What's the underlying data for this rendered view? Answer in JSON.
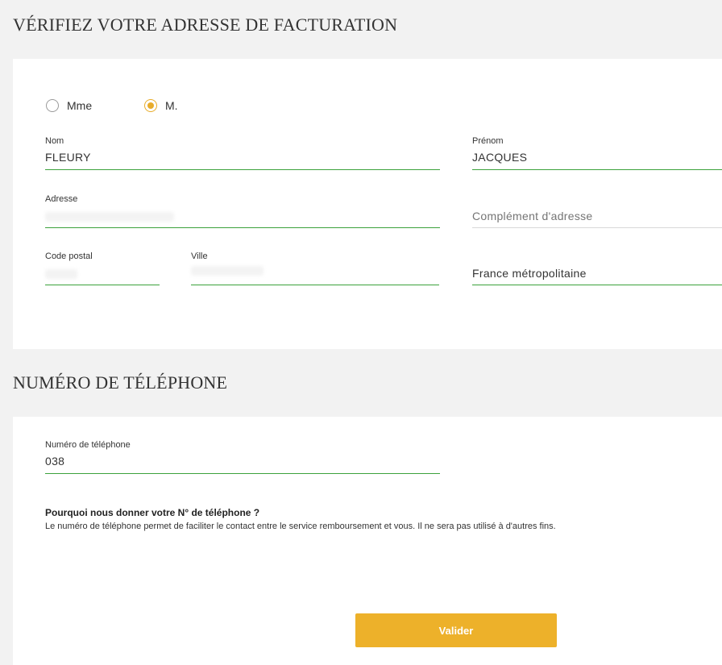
{
  "billing": {
    "title": "VÉRIFIEZ VOTRE ADRESSE DE FACTURATION",
    "civility": {
      "options": [
        {
          "label": "Mme",
          "checked": false
        },
        {
          "label": "M.",
          "checked": true
        }
      ]
    },
    "nom": {
      "label": "Nom",
      "value": "FLEURY"
    },
    "prenom": {
      "label": "Prénom",
      "value": "JACQUES"
    },
    "adresse": {
      "label": "Adresse",
      "value": ""
    },
    "complement": {
      "placeholder": "Complément d'adresse"
    },
    "code_postal": {
      "label": "Code postal",
      "value": ""
    },
    "ville": {
      "label": "Ville",
      "value": ""
    },
    "pays": {
      "value": "France métropolitaine"
    }
  },
  "phone": {
    "title": "NUMÉRO DE TÉLÉPHONE",
    "numero": {
      "label": "Numéro de téléphone",
      "value": "038"
    },
    "info_title": "Pourquoi nous donner votre N° de téléphone ?",
    "info_text": "Le numéro de téléphone permet de faciliter le contact entre le service remboursement et vous. Il ne sera pas utilisé à d'autres fins.",
    "submit_label": "Valider"
  },
  "colors": {
    "accent": "#edb12a",
    "field_underline": "#3ca23c",
    "background": "#f2f2f2",
    "card": "#ffffff"
  }
}
